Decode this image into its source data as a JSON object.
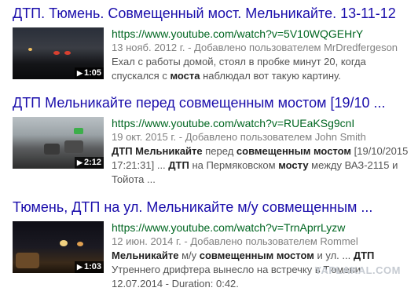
{
  "results": [
    {
      "title": "ДТП. Тюмень. Совмещенный мост. Мельникайте. 13-11-12",
      "url": "https://www.youtube.com/watch?v=5V10WQGEHrY",
      "duration": "1:05",
      "date_line": "13 нояб. 2012 г. - Добавлено пользователем MrDredfergeson",
      "snippet": [
        {
          "t": "Ехал с работы домой, стоял в пробке минут 20, когда спускался с ",
          "b": false
        },
        {
          "t": "моста",
          "b": true
        },
        {
          "t": " наблюдал вот такую картину.",
          "b": false
        }
      ]
    },
    {
      "title": "ДТП Мельникайте перед совмещенным мостом [19/10 ...",
      "url": "https://www.youtube.com/watch?v=RUEaKSg9cnI",
      "duration": "2:12",
      "date_line": "19 окт. 2015 г. - Добавлено пользователем John Smith",
      "snippet": [
        {
          "t": "ДТП Мельникайте",
          "b": true
        },
        {
          "t": " перед ",
          "b": false
        },
        {
          "t": "совмещенным мостом",
          "b": true
        },
        {
          "t": " [19/10/2015 17:21:31] ... ",
          "b": false
        },
        {
          "t": "ДТП",
          "b": true
        },
        {
          "t": " на Пермяковском ",
          "b": false
        },
        {
          "t": "мосту",
          "b": true
        },
        {
          "t": " между ВАЗ-2115 и Тойота ...",
          "b": false
        }
      ]
    },
    {
      "title": "Тюмень, ДТП на ул. Мельникайте м/у совмещенным ...",
      "url": "https://www.youtube.com/watch?v=TrnAprrLyzw",
      "duration": "1:03",
      "date_line": "12 июн. 2014 г. - Добавлено пользователем Rommel",
      "snippet": [
        {
          "t": "Мельникайте",
          "b": true
        },
        {
          "t": " м/у ",
          "b": false
        },
        {
          "t": "совмещенным мостом",
          "b": true
        },
        {
          "t": " и ул. ... ",
          "b": false
        },
        {
          "t": "ДТП",
          "b": true
        },
        {
          "t": " Утреннего дрифтера вынесло на встречку в Тюмени 12.07.2014 - Duration: 0:42.",
          "b": false
        }
      ]
    }
  ],
  "watermark": "YAPLAKAL.COM",
  "colors": {
    "title": "#1a0dab",
    "url": "#006621",
    "text": "#545454",
    "date": "#808080"
  }
}
